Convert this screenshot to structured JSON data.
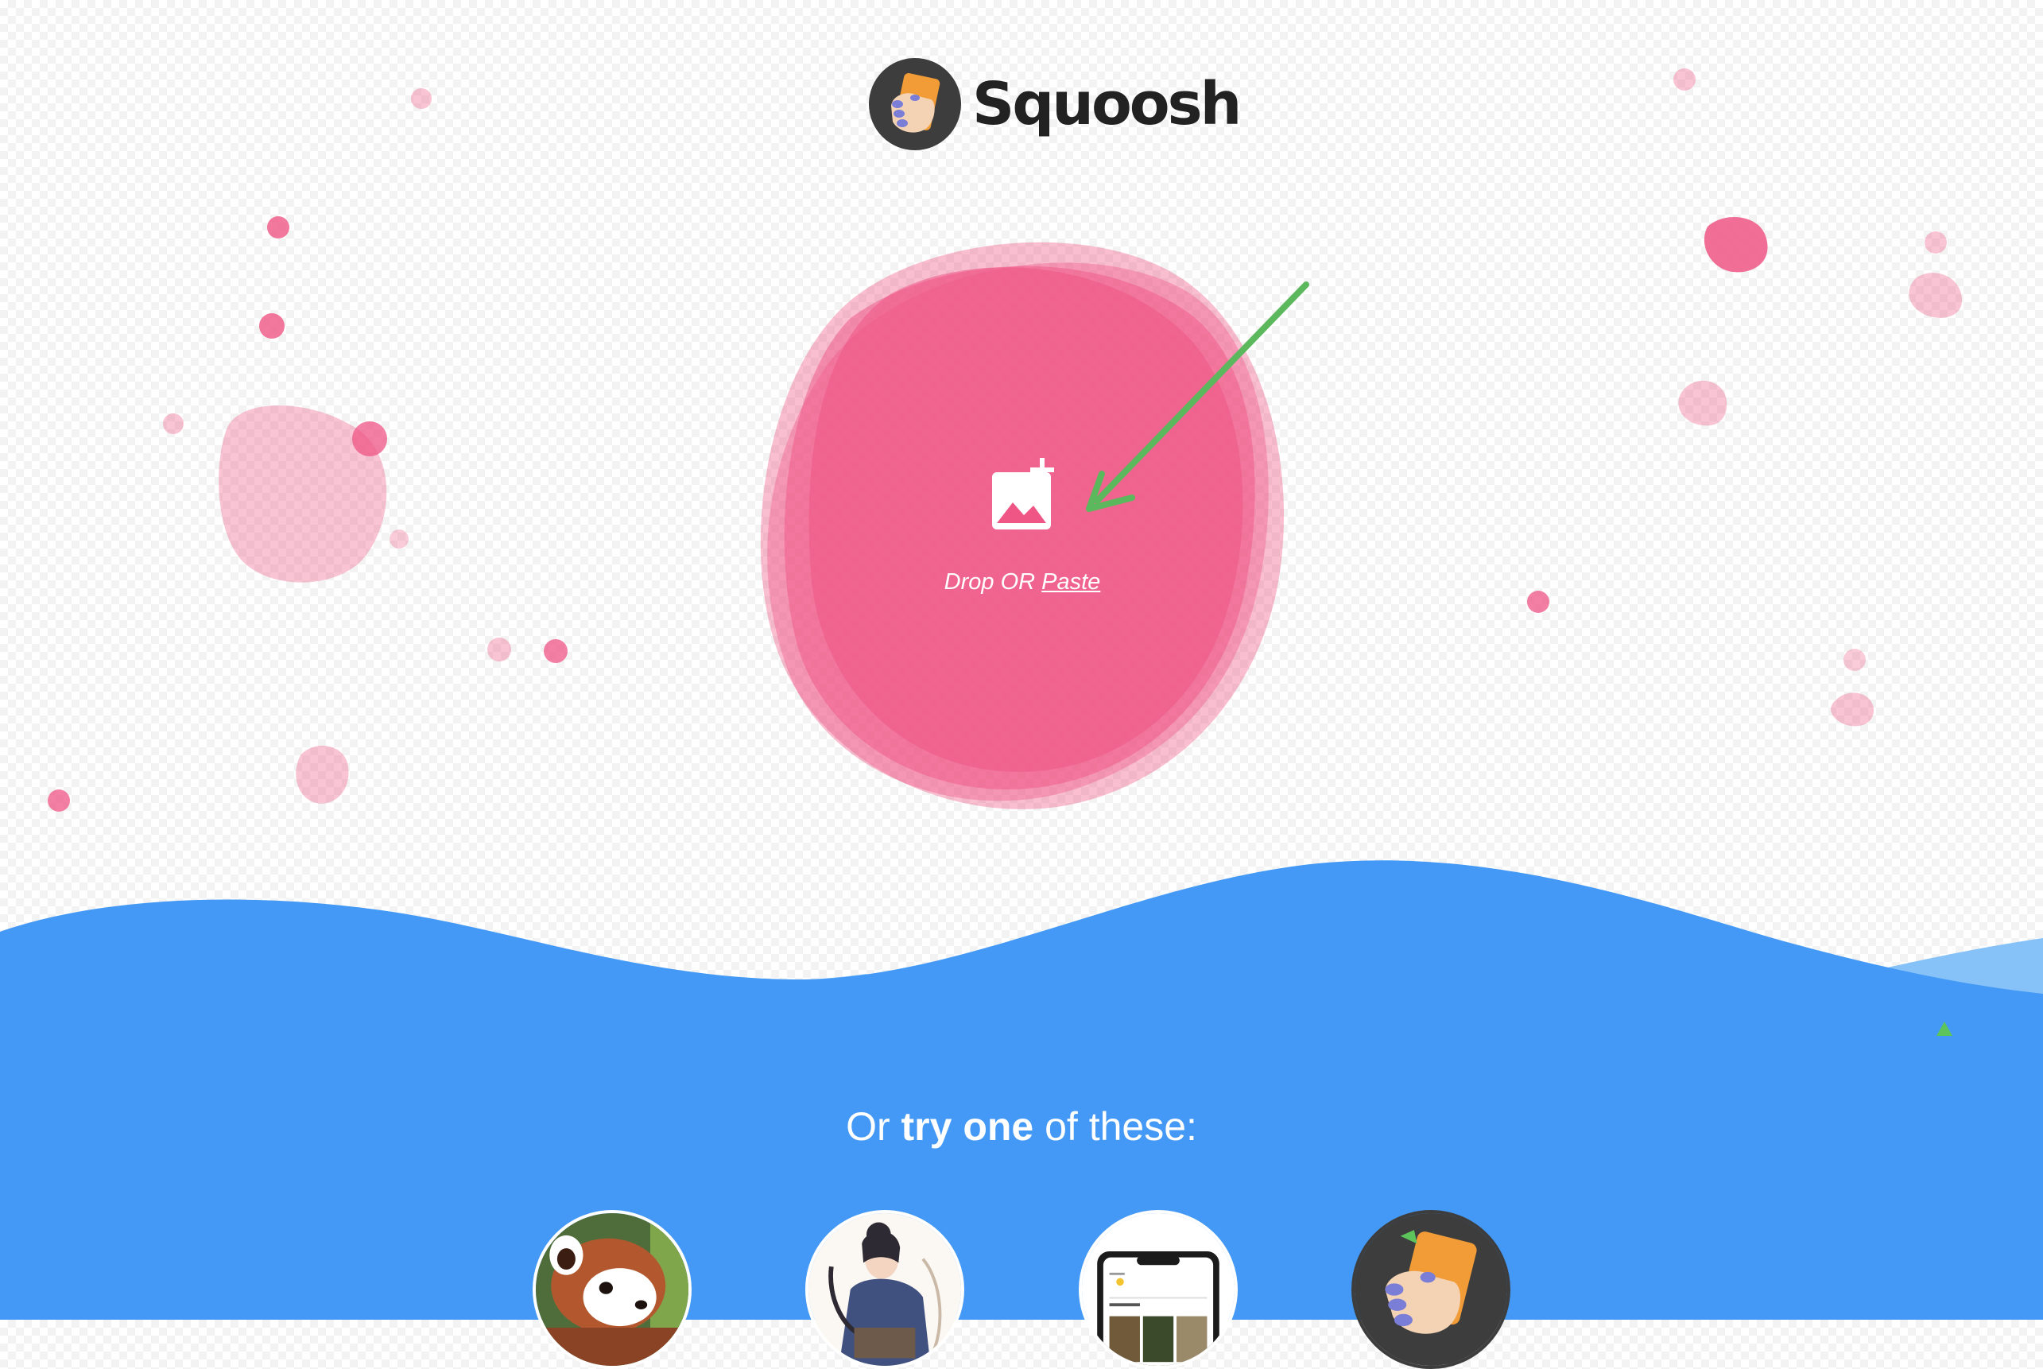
{
  "app": {
    "title": "Squoosh"
  },
  "drop": {
    "drop_text": "Drop OR ",
    "paste_label": "Paste"
  },
  "demos": {
    "heading_pre": "Or ",
    "heading_bold": "try one",
    "heading_post": " of these:",
    "items": [
      {
        "icon": "red-panda-photo"
      },
      {
        "icon": "artwork-illustration"
      },
      {
        "icon": "device-screenshot"
      },
      {
        "icon": "squoosh-logo"
      }
    ]
  },
  "colors": {
    "accent_pink": "#ef5685",
    "wave_blue": "#4399f5",
    "wave_light_blue": "#86c2f8",
    "annotation_green": "#5cb85c",
    "logo_dark": "#3d3d3d",
    "logo_orange": "#f29c38"
  }
}
